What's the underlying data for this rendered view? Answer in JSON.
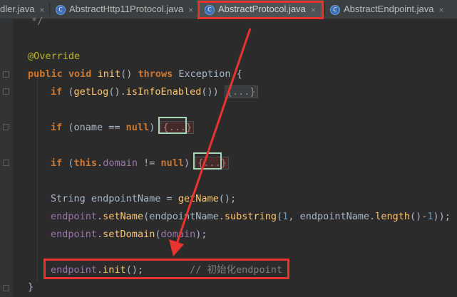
{
  "tabs": [
    {
      "label": "dler.java",
      "has_icon": false
    },
    {
      "label": "AbstractHttp11Protocol.java",
      "has_icon": true
    },
    {
      "label": "AbstractProtocol.java",
      "has_icon": true,
      "active": true
    },
    {
      "label": "AbstractEndpoint.java",
      "has_icon": true
    }
  ],
  "icons": {
    "class_icon": "C",
    "close": "×"
  },
  "code": {
    "l1": "*/",
    "override": "@Override",
    "sig_public": "public",
    "sig_void": "void",
    "sig_init": "init",
    "sig_parens": "() ",
    "sig_throws": "throws",
    "sig_exc": " Exception {",
    "if1_if": "if",
    "if1_a": " (",
    "if1_getlog": "getLog",
    "if1_b": "().",
    "if1_isinfo": "isInfoEnabled",
    "if1_c": "()) ",
    "fold": "{...}",
    "if2_if": "if",
    "if2_a": " (oname == ",
    "if2_null": "null",
    "if2_b": ") ",
    "if3_if": "if",
    "if3_a": " (",
    "if3_this": "this",
    "if3_b": ".",
    "if3_domain": "domain",
    "if3_c": " != ",
    "if3_null": "null",
    "if3_d": ") ",
    "s1_a": "String endpointName = ",
    "s1_getname": "getName",
    "s1_b": "();",
    "s2_endpoint": "endpoint",
    "s2_a": ".",
    "s2_setname": "setName",
    "s2_b": "(endpointName.",
    "s2_substring": "substring",
    "s2_c": "(",
    "s2_1": "1",
    "s2_d": ", endpointName.",
    "s2_length": "length",
    "s2_e": "()-",
    "s2_2": "1",
    "s2_f": "));",
    "s3_endpoint": "endpoint",
    "s3_a": ".",
    "s3_setdomain": "setDomain",
    "s3_b": "(",
    "s3_domain": "domain",
    "s3_c": ");",
    "s4_endpoint": "endpoint",
    "s4_a": ".",
    "s4_init": "init",
    "s4_b": "();        ",
    "s4_comment": "// 初始化endpoint",
    "closing": "}"
  },
  "colors": {
    "highlight_red": "#e8332e",
    "highlight_green": "#a8d7b6"
  }
}
